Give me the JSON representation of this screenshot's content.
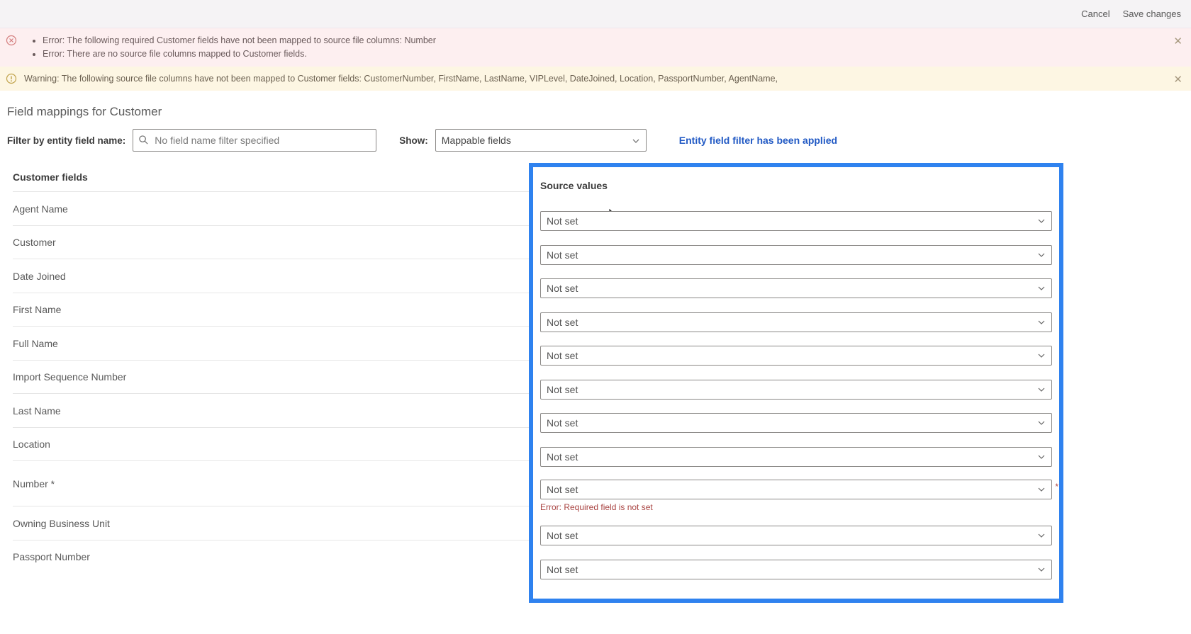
{
  "topbar": {
    "cancel": "Cancel",
    "save": "Save changes"
  },
  "banners": {
    "error": {
      "line1": "Error: The following required Customer fields have not been mapped to source file columns: Number",
      "line2": "Error: There are no source file columns mapped to Customer fields."
    },
    "warning": "Warning: The following source file columns have not been mapped to Customer fields: CustomerNumber, FirstName, LastName, VIPLevel, DateJoined, Location, PassportNumber, AgentName,"
  },
  "page_title": "Field mappings for Customer",
  "filter": {
    "label": "Filter by entity field name:",
    "placeholder": "No field name filter specified",
    "show_label": "Show:",
    "show_value": "Mappable fields",
    "applied_msg": "Entity field filter has been applied"
  },
  "columns": {
    "left": "Customer fields",
    "right": "Source values"
  },
  "notset": "Not set",
  "err_required": "Error: Required field is not set",
  "fields": {
    "f0": "Agent Name",
    "f1": "Customer",
    "f2": "Date Joined",
    "f3": "First Name",
    "f4": "Full Name",
    "f5": "Import Sequence Number",
    "f6": "Last Name",
    "f7": "Location",
    "f8": "Number *",
    "f9": "Owning Business Unit",
    "f10": "Passport Number"
  }
}
